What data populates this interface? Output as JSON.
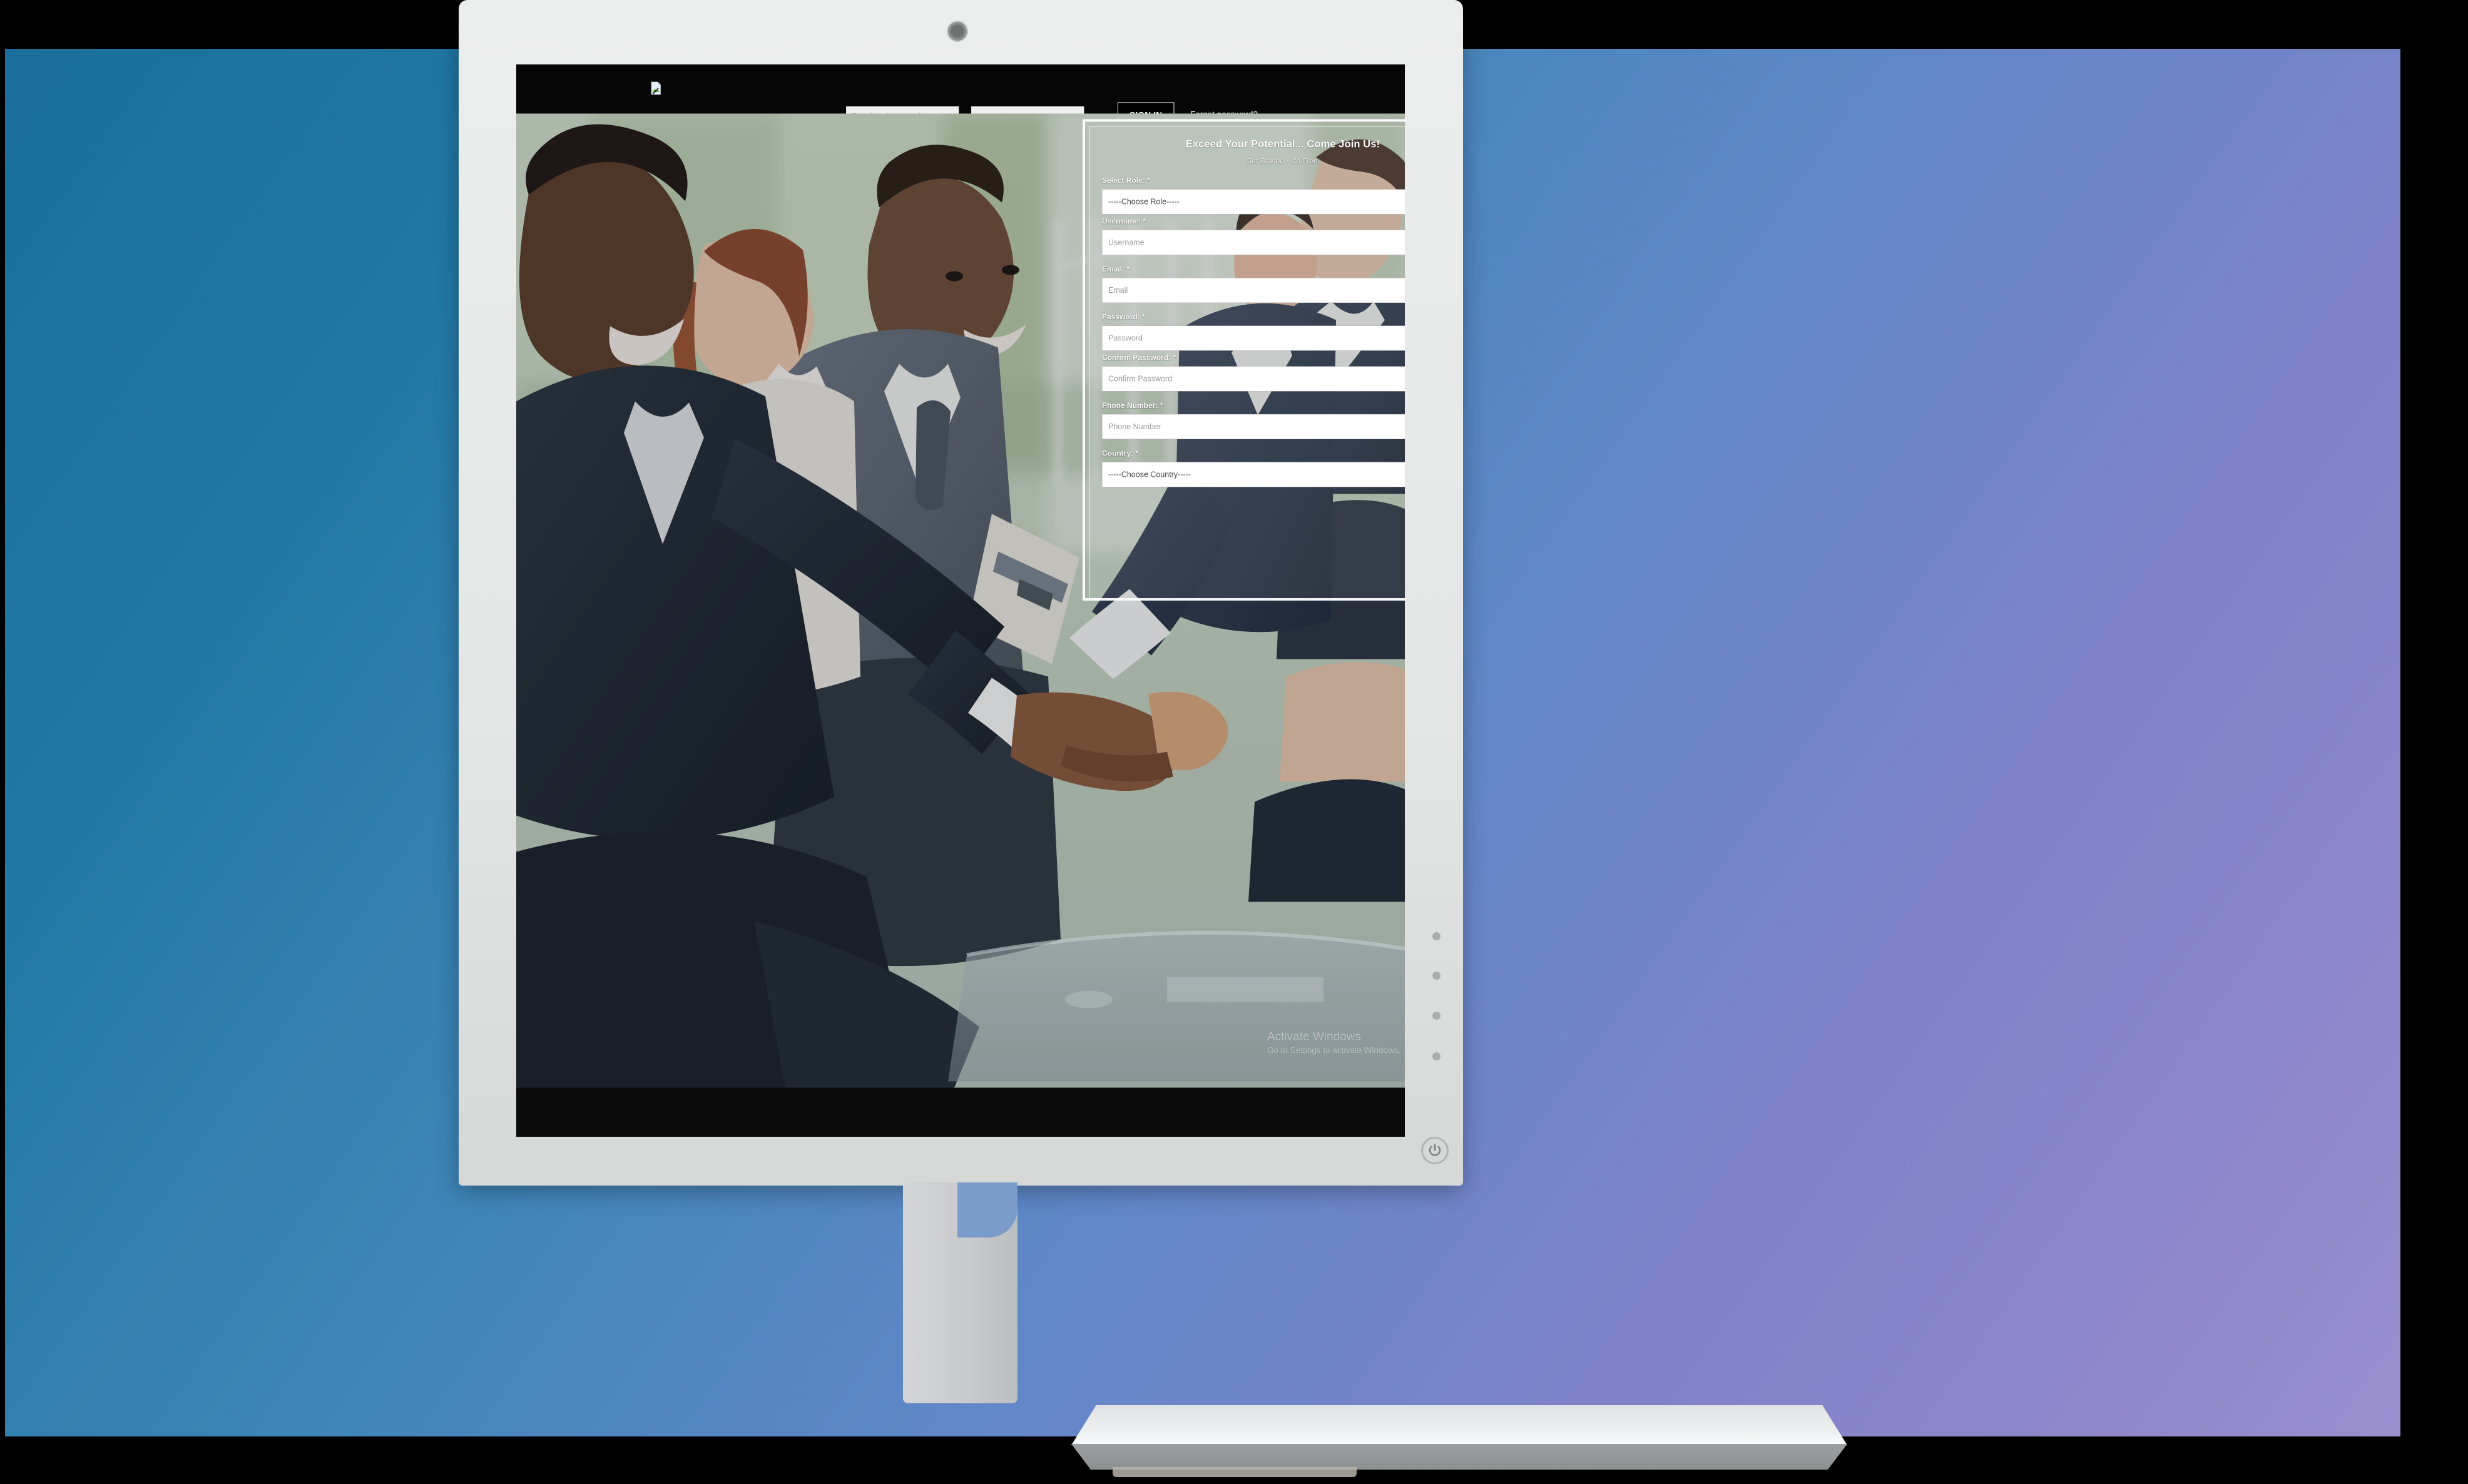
{
  "navbar": {
    "logo_icon": "broken-image-icon",
    "email_placeholder": "E-mail or phone number",
    "email_value": "",
    "password_placeholder": "password",
    "password_value": "",
    "signin_label": "SIGN IN",
    "forgot_label": "Forgot password?"
  },
  "signup": {
    "title": "Exceed Your Potential... Come Join Us!",
    "subtitle": "Get Started - It's Free.",
    "fields": [
      {
        "label": "Select Role: *",
        "type": "select",
        "value": "-----Choose Role-----",
        "name": "select-role"
      },
      {
        "label": "Username: *",
        "type": "text",
        "placeholder": "Username",
        "value": "",
        "name": "username"
      },
      {
        "label": "Email: *",
        "type": "email",
        "placeholder": "Email",
        "value": "",
        "name": "email"
      },
      {
        "label": "Password: *",
        "type": "password",
        "placeholder": "Password",
        "value": "",
        "name": "password"
      },
      {
        "label": "Confirm Password: *",
        "type": "password",
        "placeholder": "Confirm Password",
        "value": "",
        "name": "confirm-password"
      },
      {
        "label": "Phone Number: *",
        "type": "tel",
        "placeholder": "Phone Number",
        "value": "",
        "name": "phone-number"
      },
      {
        "label": "Country: *",
        "type": "select",
        "value": "-----Choose Country-----",
        "name": "country"
      }
    ]
  },
  "watermark": {
    "title": "Activate Windows",
    "subtitle": "Go to Settings to activate Windows."
  },
  "hero": {
    "description": "Business people shaking hands in a meeting"
  },
  "monitor": {
    "webcam_icon": "webcam-icon",
    "power_icon": "power-icon",
    "osd_button_count": 4
  },
  "colors": {
    "navbar_bg": "#060606",
    "wallpaper_start": "#1b6e9c",
    "wallpaper_end": "#9a8fcf",
    "bezel": "#e4e6e6",
    "card_border": "#ffffff",
    "input_bg": "#ffffff"
  }
}
